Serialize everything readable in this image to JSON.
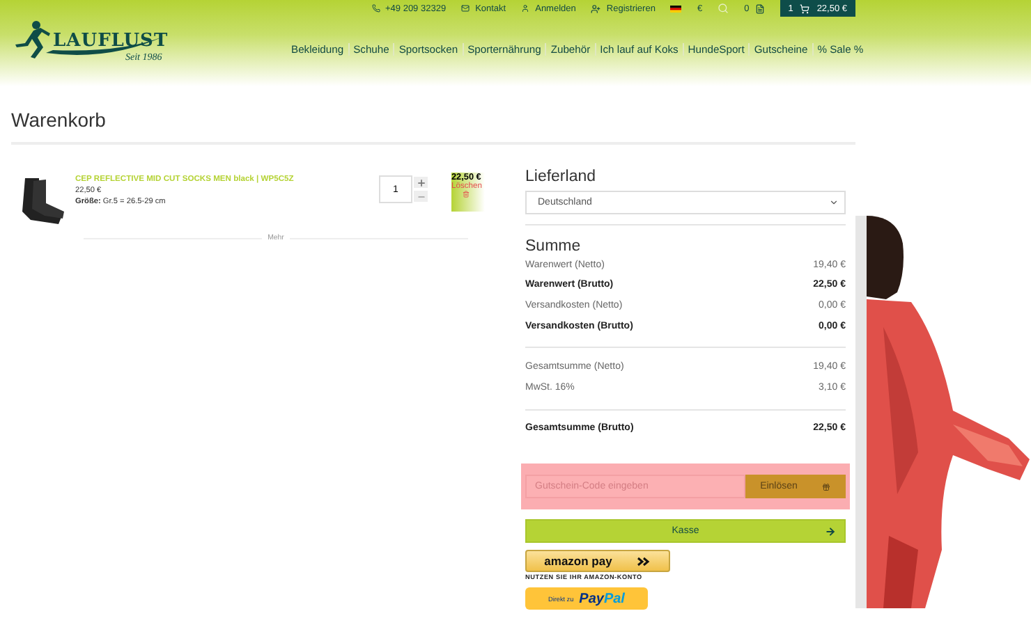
{
  "topbar": {
    "phone": "+49 209 32329",
    "contact": "Kontakt",
    "login": "Anmelden",
    "register": "Registrieren",
    "currency": "€",
    "wishlist_count": "0",
    "cart": {
      "count": "1",
      "total": "22,50 €"
    }
  },
  "logo": {
    "name": "LAUFLUST",
    "tagline": "Seit 1986"
  },
  "nav": [
    "Bekleidung",
    "Schuhe",
    "Sportsocken",
    "Sporternährung",
    "Zubehör",
    "Ich lauf auf Koks",
    "HundeSport",
    "Gutscheine",
    "% Sale %"
  ],
  "page_title": "Warenkorb",
  "cart_items": [
    {
      "name": "CEP REFLECTIVE MID CUT SOCKS MEN black | WP5C5Z",
      "price": "22,50 €",
      "size": "**Größe:** Gr.5 = 26.5-29 cm",
      "quantity": "1",
      "total": "22,50 €",
      "delete": "Löschen",
      "more": "Mehr"
    }
  ],
  "shipping": {
    "title": "Lieferland",
    "country": "Deutschland"
  },
  "summary": {
    "title": "Summe",
    "groups": [
      [
        {
          "label": "Warenwert (Netto)",
          "value": "19,40 €",
          "bold": false
        },
        {
          "label": "Warenwert (Brutto)",
          "value": "22,50 €",
          "bold": true
        },
        {
          "label": "Versandkosten (Netto)",
          "value": "0,00 €",
          "bold": false
        },
        {
          "label": "Versandkosten (Brutto)",
          "value": "0,00 €",
          "bold": true
        }
      ],
      [
        {
          "label": "Gesamtsumme (Netto)",
          "value": "19,40 €",
          "bold": false
        },
        {
          "label": "MwSt. 16%",
          "value": "3,10 €",
          "bold": false
        }
      ],
      [
        {
          "label": "Gesamtsumme (Brutto)",
          "value": "22,50 €",
          "bold": true
        }
      ]
    ]
  },
  "coupon": {
    "placeholder": "Gutschein-Code eingeben",
    "button": "Einlösen"
  },
  "checkout": "Kasse",
  "amazon": {
    "label": "amazon pay",
    "caption": "NUTZEN SIE IHR AMAZON-KONTO"
  },
  "paypal": {
    "prefix": "Direkt zu",
    "brand_1": "Pay",
    "brand_2": "Pal"
  }
}
